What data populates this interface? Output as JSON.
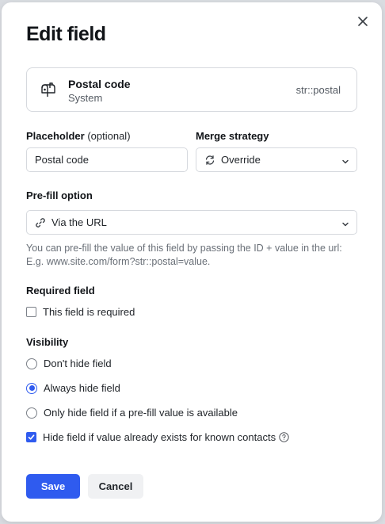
{
  "dialog": {
    "title": "Edit field"
  },
  "field": {
    "name": "Postal code",
    "subtitle": "System",
    "key": "str::postal",
    "icon": "mailbox-icon"
  },
  "placeholder": {
    "label": "Placeholder",
    "optional": "(optional)",
    "value": "Postal code"
  },
  "merge": {
    "label": "Merge strategy",
    "selected": "Override",
    "icon": "refresh-icon"
  },
  "prefill": {
    "label": "Pre-fill option",
    "selected": "Via the URL",
    "icon": "link-icon",
    "help_line1": "You can pre-fill the value of this field by passing the ID + value in the url:",
    "help_line2": "E.g. www.site.com/form?str::postal=value."
  },
  "required": {
    "label": "Required field",
    "checkbox_label": "This field is required",
    "checked": false
  },
  "visibility": {
    "label": "Visibility",
    "options": [
      {
        "label": "Don't hide field",
        "selected": false
      },
      {
        "label": "Always hide field",
        "selected": true
      },
      {
        "label": "Only hide field if a pre-fill value is available",
        "selected": false
      }
    ],
    "hide_known_label": "Hide field if value already exists for known contacts",
    "hide_known_checked": true
  },
  "actions": {
    "save": "Save",
    "cancel": "Cancel"
  },
  "colors": {
    "accent": "#2f5bef",
    "border": "#d6d9de",
    "muted_text": "#6a7078"
  }
}
